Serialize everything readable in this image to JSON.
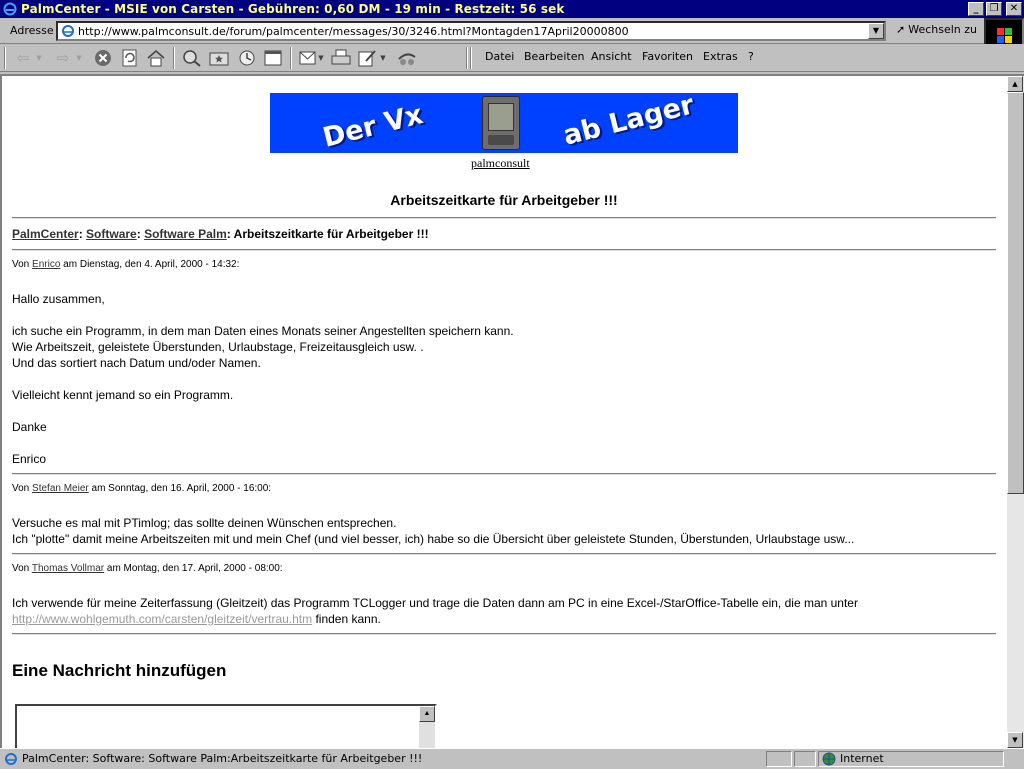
{
  "window": {
    "title": "PalmCenter - MSIE von Carsten - Gebühren: 0,60 DM - 19 min - Restzeit: 56 sek"
  },
  "address": {
    "label": "Adresse",
    "url": "http://www.palmconsult.de/forum/palmcenter/messages/30/3246.html?Montagden17April20000800",
    "go_label": "Wechseln zu"
  },
  "menu": [
    "Datei",
    "Bearbeiten",
    "Ansicht",
    "Favoriten",
    "Extras",
    "?"
  ],
  "toolbar": {
    "icons": [
      "back-icon",
      "forward-icon",
      "stop-icon",
      "refresh-icon",
      "home-icon",
      "search-icon",
      "favorites-icon",
      "history-icon",
      "fullscreen-icon",
      "mail-icon",
      "print-icon",
      "edit-icon",
      "discuss-icon"
    ]
  },
  "page": {
    "banner": {
      "text_left": "Der Vx",
      "text_right": "ab Lager"
    },
    "banner_link": "palmconsult",
    "heading": "Arbeitszeitkarte für Arbeitgeber !!!",
    "breadcrumb": {
      "items": [
        "PalmCenter",
        "Software",
        "Software Palm"
      ],
      "current": "Arbeitszeitkarte für Arbeitgeber !!!"
    },
    "messages": [
      {
        "prefix": "Von",
        "author": "Enrico",
        "date": "am Dienstag, den 4. April, 2000 - 14:32:",
        "body": "Hallo zusammen,\n\nich suche ein Programm, in dem man Daten eines Monats seiner Angestellten speichern kann.\nWie Arbeitszeit, geleistete Überstunden, Urlaubstage, Freizeitausgleich usw. .\nUnd das sortiert nach Datum und/oder Namen.\n\nVielleicht kennt jemand so ein Programm.\n\nDanke\n\nEnrico"
      },
      {
        "prefix": "Von",
        "author": "Stefan Meier",
        "date": "am Sonntag, den 16. April, 2000 - 16:00:",
        "body": "Versuche es mal mit PTimlog; das sollte deinen Wünschen entsprechen.\nIch \"plotte\" damit meine Arbeitszeiten mit und mein Chef (und viel besser, ich) habe so die Übersicht über geleistete Stunden, Überstunden, Urlaubstage usw..."
      },
      {
        "prefix": "Von",
        "author": "Thomas Vollmar",
        "date": "am Montag, den 17. April, 2000 - 08:00:",
        "body_line1": "Ich verwende für meine Zeiterfassung (Gleitzeit) das Programm TCLogger und trage die Daten dann am PC in eine Excel-/StarOffice-Tabelle ein, die man unter",
        "link": "http://www.wohlgemuth.com/carsten/gleitzeit/vertrau.htm",
        "body_line2_suffix": " finden kann."
      }
    ],
    "add_message_heading": "Eine Nachricht hinzufügen"
  },
  "status": {
    "text": "PalmCenter: Software: Software Palm:Arbeitszeitkarte für Arbeitgeber !!!",
    "zone": "Internet"
  }
}
